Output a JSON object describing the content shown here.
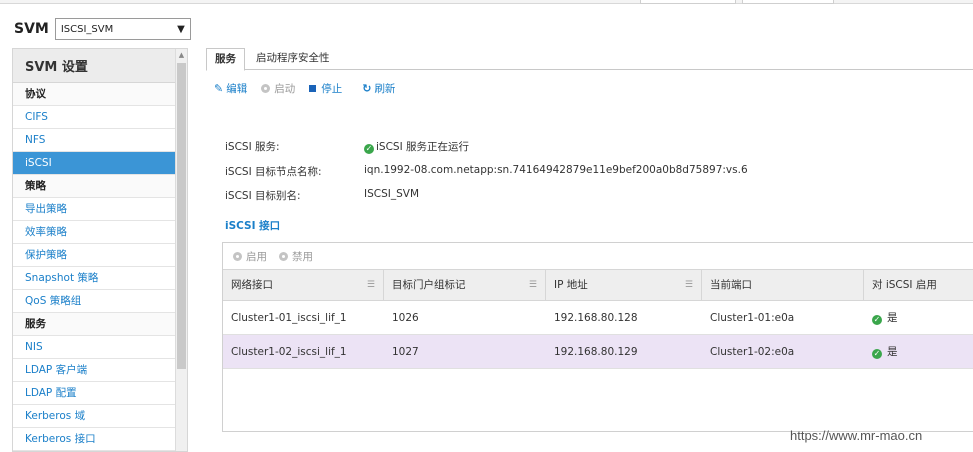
{
  "svm": {
    "label": "SVM",
    "selected": "ISCSI_SVM"
  },
  "sidebar": {
    "header": "SVM 设置",
    "items": [
      {
        "label": "协议",
        "kind": "section"
      },
      {
        "label": "CIFS",
        "kind": "link"
      },
      {
        "label": "NFS",
        "kind": "link"
      },
      {
        "label": "iSCSI",
        "kind": "active"
      },
      {
        "label": "策略",
        "kind": "section"
      },
      {
        "label": "导出策略",
        "kind": "link"
      },
      {
        "label": "效率策略",
        "kind": "link"
      },
      {
        "label": "保护策略",
        "kind": "link"
      },
      {
        "label": "Snapshot 策略",
        "kind": "link"
      },
      {
        "label": "QoS 策略组",
        "kind": "link"
      },
      {
        "label": "服务",
        "kind": "section"
      },
      {
        "label": "NIS",
        "kind": "link"
      },
      {
        "label": "LDAP 客户端",
        "kind": "link"
      },
      {
        "label": "LDAP 配置",
        "kind": "link"
      },
      {
        "label": "Kerberos 域",
        "kind": "link"
      },
      {
        "label": "Kerberos 接口",
        "kind": "link"
      }
    ]
  },
  "tabs": [
    {
      "label": "服务",
      "active": true
    },
    {
      "label": "启动程序安全性",
      "active": false
    }
  ],
  "toolbar": {
    "edit": "编辑",
    "start": "启动",
    "stop": "停止",
    "refresh": "刷新"
  },
  "info": {
    "service_label": "iSCSI 服务:",
    "service_value": "iSCSI 服务正在运行",
    "node_label": "iSCSI 目标节点名称:",
    "node_value": "iqn.1992-08.com.netapp:sn.74164942879e11e9bef200a0b8d75897:vs.6",
    "alias_label": "iSCSI 目标别名:",
    "alias_value": "ISCSI_SVM"
  },
  "interfaces": {
    "title": "iSCSI 接口",
    "enable": "启用",
    "disable": "禁用",
    "columns": [
      "网络接口",
      "目标门户组标记",
      "IP 地址",
      "当前端口",
      "对 iSCSI 启用"
    ],
    "rows": [
      {
        "iface": "Cluster1-01_iscsi_lif_1",
        "tpgt": "1026",
        "ip": "192.168.80.128",
        "port": "Cluster1-01:e0a",
        "enabled": "是"
      },
      {
        "iface": "Cluster1-02_iscsi_lif_1",
        "tpgt": "1027",
        "ip": "192.168.80.129",
        "port": "Cluster1-02:e0a",
        "enabled": "是"
      }
    ]
  },
  "watermark": "https://www.mr-mao.cn",
  "colors": {
    "accent": "#1a7fc9",
    "active": "#3b95d6",
    "ok": "#3aa64b",
    "selected_row": "#ece3f5"
  }
}
